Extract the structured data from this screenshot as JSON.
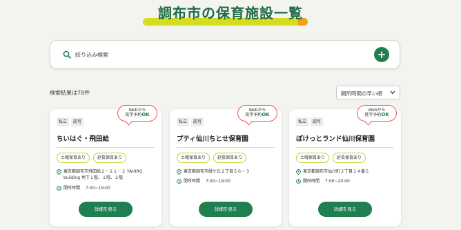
{
  "page": {
    "title": "調布市の保育施設一覧"
  },
  "colors": {
    "accent_green": "#1f7f4f",
    "title_green": "#1f6b45",
    "highlight_yellow": "#d6dc20",
    "highlight_orange": "#f0a11c",
    "badge_red": "#e35a5a",
    "pill_border": "#c6d21e"
  },
  "search": {
    "placeholder": "絞り込み検索",
    "icon": "search-icon",
    "add_icon": "plus-icon",
    "add_label": "+"
  },
  "results": {
    "count_text": "検索結果は78件"
  },
  "sort": {
    "selected": "開所時間の早い順",
    "icon": "chevron-down-icon"
  },
  "cards": [
    {
      "tags": [
        "私立",
        "認可"
      ],
      "badge": {
        "line1": "Webから",
        "line2": "見学予約",
        "ok": "OK"
      },
      "name": "ちいはぐ・飛田給",
      "services": [
        "土曜保育あり",
        "延長保育あり"
      ],
      "address": "東京都調布市飛田給２－２１－２ YAHIRO building 地下１階、１階、２階",
      "hours_label": "開所時間",
      "hours": "7:00~19:00",
      "button": "詳細を見る"
    },
    {
      "tags": [
        "私立",
        "認可"
      ],
      "badge": {
        "line1": "Webから",
        "line2": "見学予約",
        "ok": "OK"
      },
      "name": "プティ仙川ちとせ保育園",
      "services": [
        "土曜保育あり",
        "延長保育あり"
      ],
      "address": "東京都調布市緑ケ丘２丁目５６－３",
      "hours_label": "開所時間",
      "hours": "7:00~19:00",
      "button": "詳細を見る"
    },
    {
      "tags": [
        "私立",
        "認可"
      ],
      "badge": {
        "line1": "Webから",
        "line2": "見学予約",
        "ok": "OK"
      },
      "name": "ぽけっとランド仙川保育園",
      "services": [
        "土曜保育あり",
        "延長保育あり"
      ],
      "address": "東京都調布市仙川町２丁目１４番５",
      "hours_label": "開所時間",
      "hours": "7:00~20:00",
      "button": "詳細を見る"
    }
  ]
}
